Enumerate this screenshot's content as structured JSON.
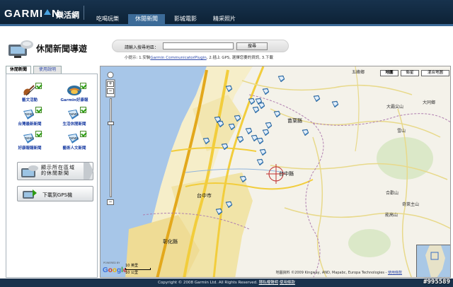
{
  "brand": {
    "logo_text": "GARMIN.",
    "logo_left": "GARMI",
    "logo_right": "N.",
    "site_name": "樂活網"
  },
  "nav": {
    "items": [
      {
        "label": "吃喝玩樂",
        "active": false
      },
      {
        "label": "休閒新聞",
        "active": true
      },
      {
        "label": "影城電影",
        "active": false
      },
      {
        "label": "精采照片",
        "active": false
      }
    ]
  },
  "page": {
    "title": "休閒新聞導遊"
  },
  "search": {
    "label": "請輸入搜尋地區：",
    "value": "",
    "button": "搜尋",
    "tip_prefix": "小提示: 1.安裝",
    "tip_link": "Garmin CommunicatorPlugin",
    "tip_suffix": ", 2.插上 GPS, 選擇您要的資訊, 3.下載"
  },
  "tabs": [
    {
      "label": "休閒新聞",
      "active": true
    },
    {
      "label": "使用說明",
      "active": false
    }
  ],
  "categories": [
    {
      "label": "藝文活動",
      "icon": "guitar-icon",
      "checked": true
    },
    {
      "label": "Garmin好康報",
      "icon": "gift-icon",
      "checked": true
    },
    {
      "label": "台灣最新新聞",
      "icon": "news-pin-icon",
      "checked": true
    },
    {
      "label": "生活休閒新聞",
      "icon": "news-pin-icon",
      "checked": true
    },
    {
      "label": "好康報報新聞",
      "icon": "news-pin-icon",
      "checked": true
    },
    {
      "label": "藝術人文新聞",
      "icon": "news-pin-icon",
      "checked": true
    }
  ],
  "buttons": {
    "show_area_line1": "顯示所在區域",
    "show_area_line2": "的休閒新聞",
    "download_gps": "下載到GPS機"
  },
  "map": {
    "types": [
      {
        "label": "地圖",
        "selected": true
      },
      {
        "label": "衛星",
        "selected": false
      },
      {
        "label": "混合地圖",
        "selected": false
      }
    ],
    "places": [
      {
        "name": "五峰鄉"
      },
      {
        "name": "大同鄉"
      },
      {
        "name": "苗栗縣"
      },
      {
        "name": "大霸尖山"
      },
      {
        "name": "雪山"
      },
      {
        "name": "台中縣"
      },
      {
        "name": "台中市"
      },
      {
        "name": "彰化縣"
      },
      {
        "name": "合歡山"
      },
      {
        "name": "能高山"
      },
      {
        "name": "奇萊主山"
      }
    ],
    "scale_top": "10 英里",
    "scale_bottom": "10 公里",
    "attribution_prefix": "地圖資料 ©2009 Kingway, AND, Mapabc, Europa Technologies - ",
    "attribution_link": "使用條款",
    "powered_by": "POWERED BY",
    "google": "Google",
    "pin_count": 28
  },
  "footer": {
    "text": "Copyright © 2008 Garmin Ltd. All Rights Reserved.",
    "link1": "隱私權聲明",
    "link2": "使用條款"
  },
  "watermark": "#995589",
  "colors": {
    "header_bg": "#17324d",
    "nav_active": "#3c6b98",
    "link": "#2a46a8",
    "check": "#2d9a12",
    "highway": "#f2cd3c",
    "pin": "#3a7fbf"
  }
}
